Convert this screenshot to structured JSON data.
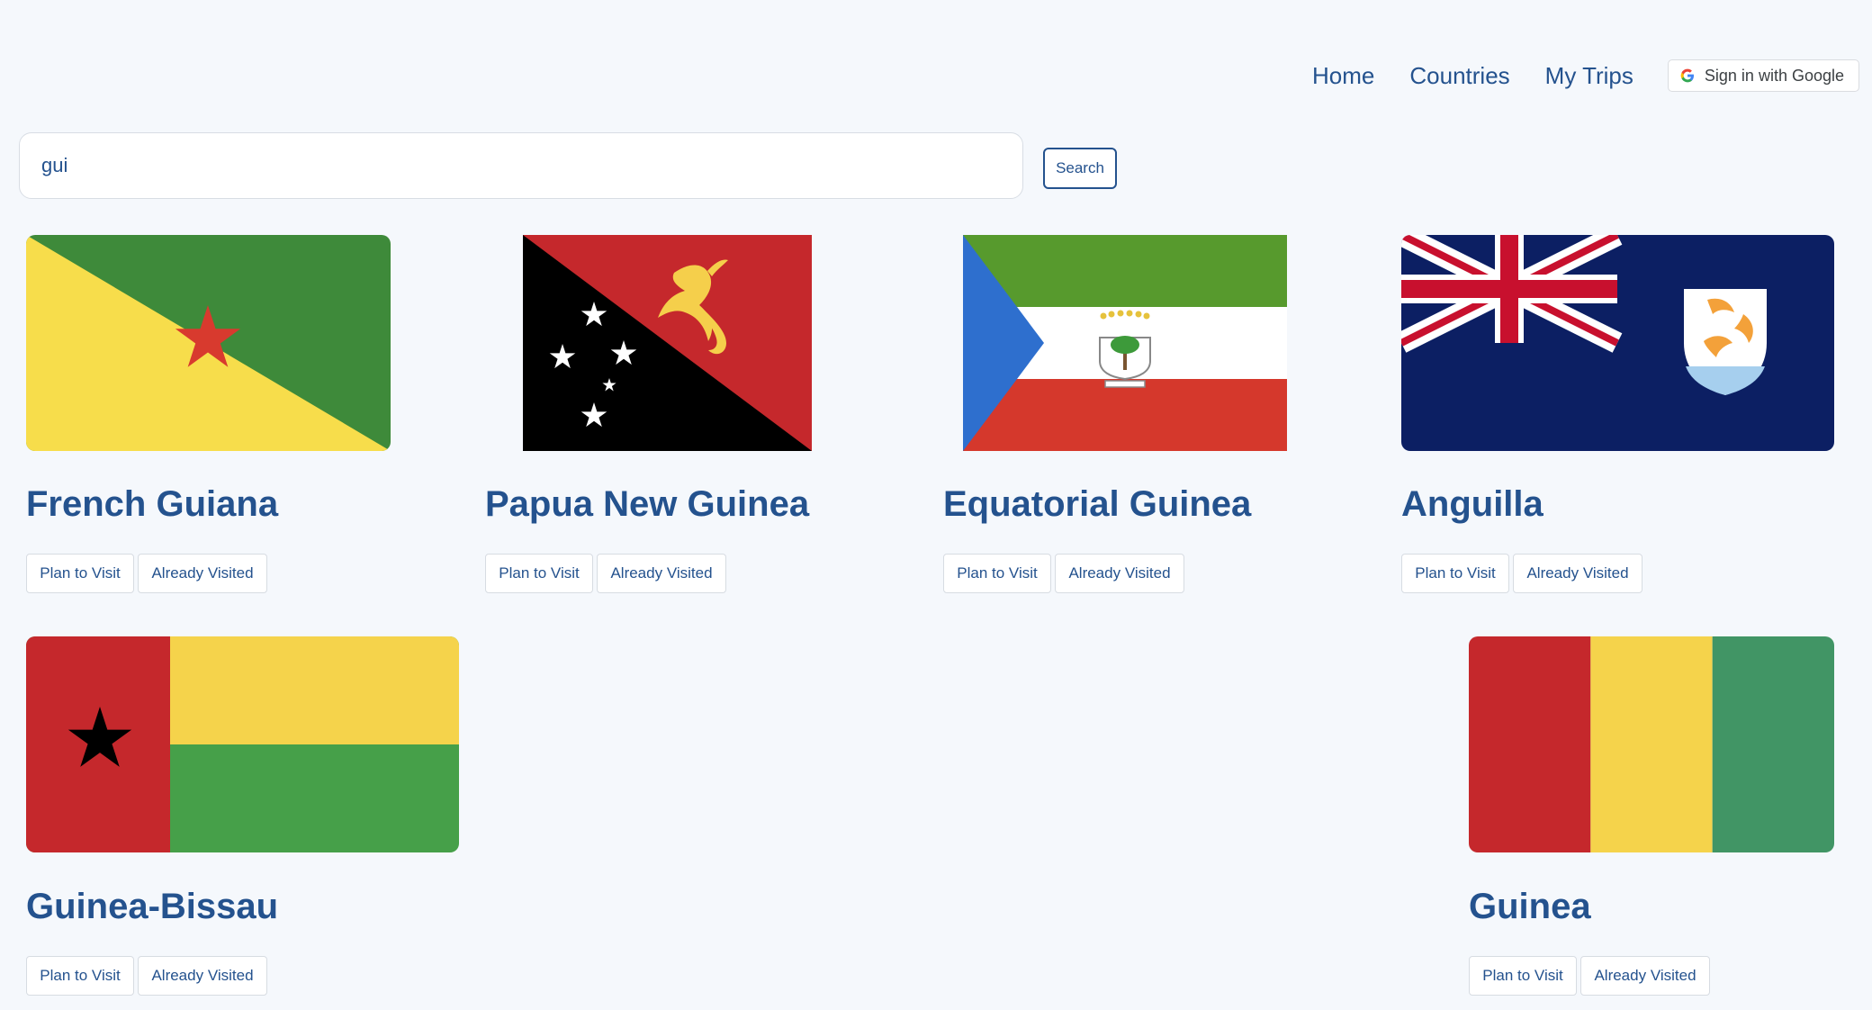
{
  "nav": {
    "items": [
      "Home",
      "Countries",
      "My Trips"
    ],
    "signin_label": "Sign in with Google"
  },
  "search": {
    "value": "gui",
    "button_label": "Search"
  },
  "countries": [
    {
      "name": "French Guiana",
      "plan_label": "Plan to Visit",
      "visited_label": "Already Visited"
    },
    {
      "name": "Papua New Guinea",
      "plan_label": "Plan to Visit",
      "visited_label": "Already Visited"
    },
    {
      "name": "Equatorial Guinea",
      "plan_label": "Plan to Visit",
      "visited_label": "Already Visited"
    },
    {
      "name": "Anguilla",
      "plan_label": "Plan to Visit",
      "visited_label": "Already Visited"
    },
    {
      "name": "Guinea-Bissau",
      "plan_label": "Plan to Visit",
      "visited_label": "Already Visited"
    },
    {
      "name": "Guinea",
      "plan_label": "Plan to Visit",
      "visited_label": "Already Visited"
    }
  ],
  "colors": {
    "accent": "#24528e",
    "background": "#f5f8fc"
  }
}
